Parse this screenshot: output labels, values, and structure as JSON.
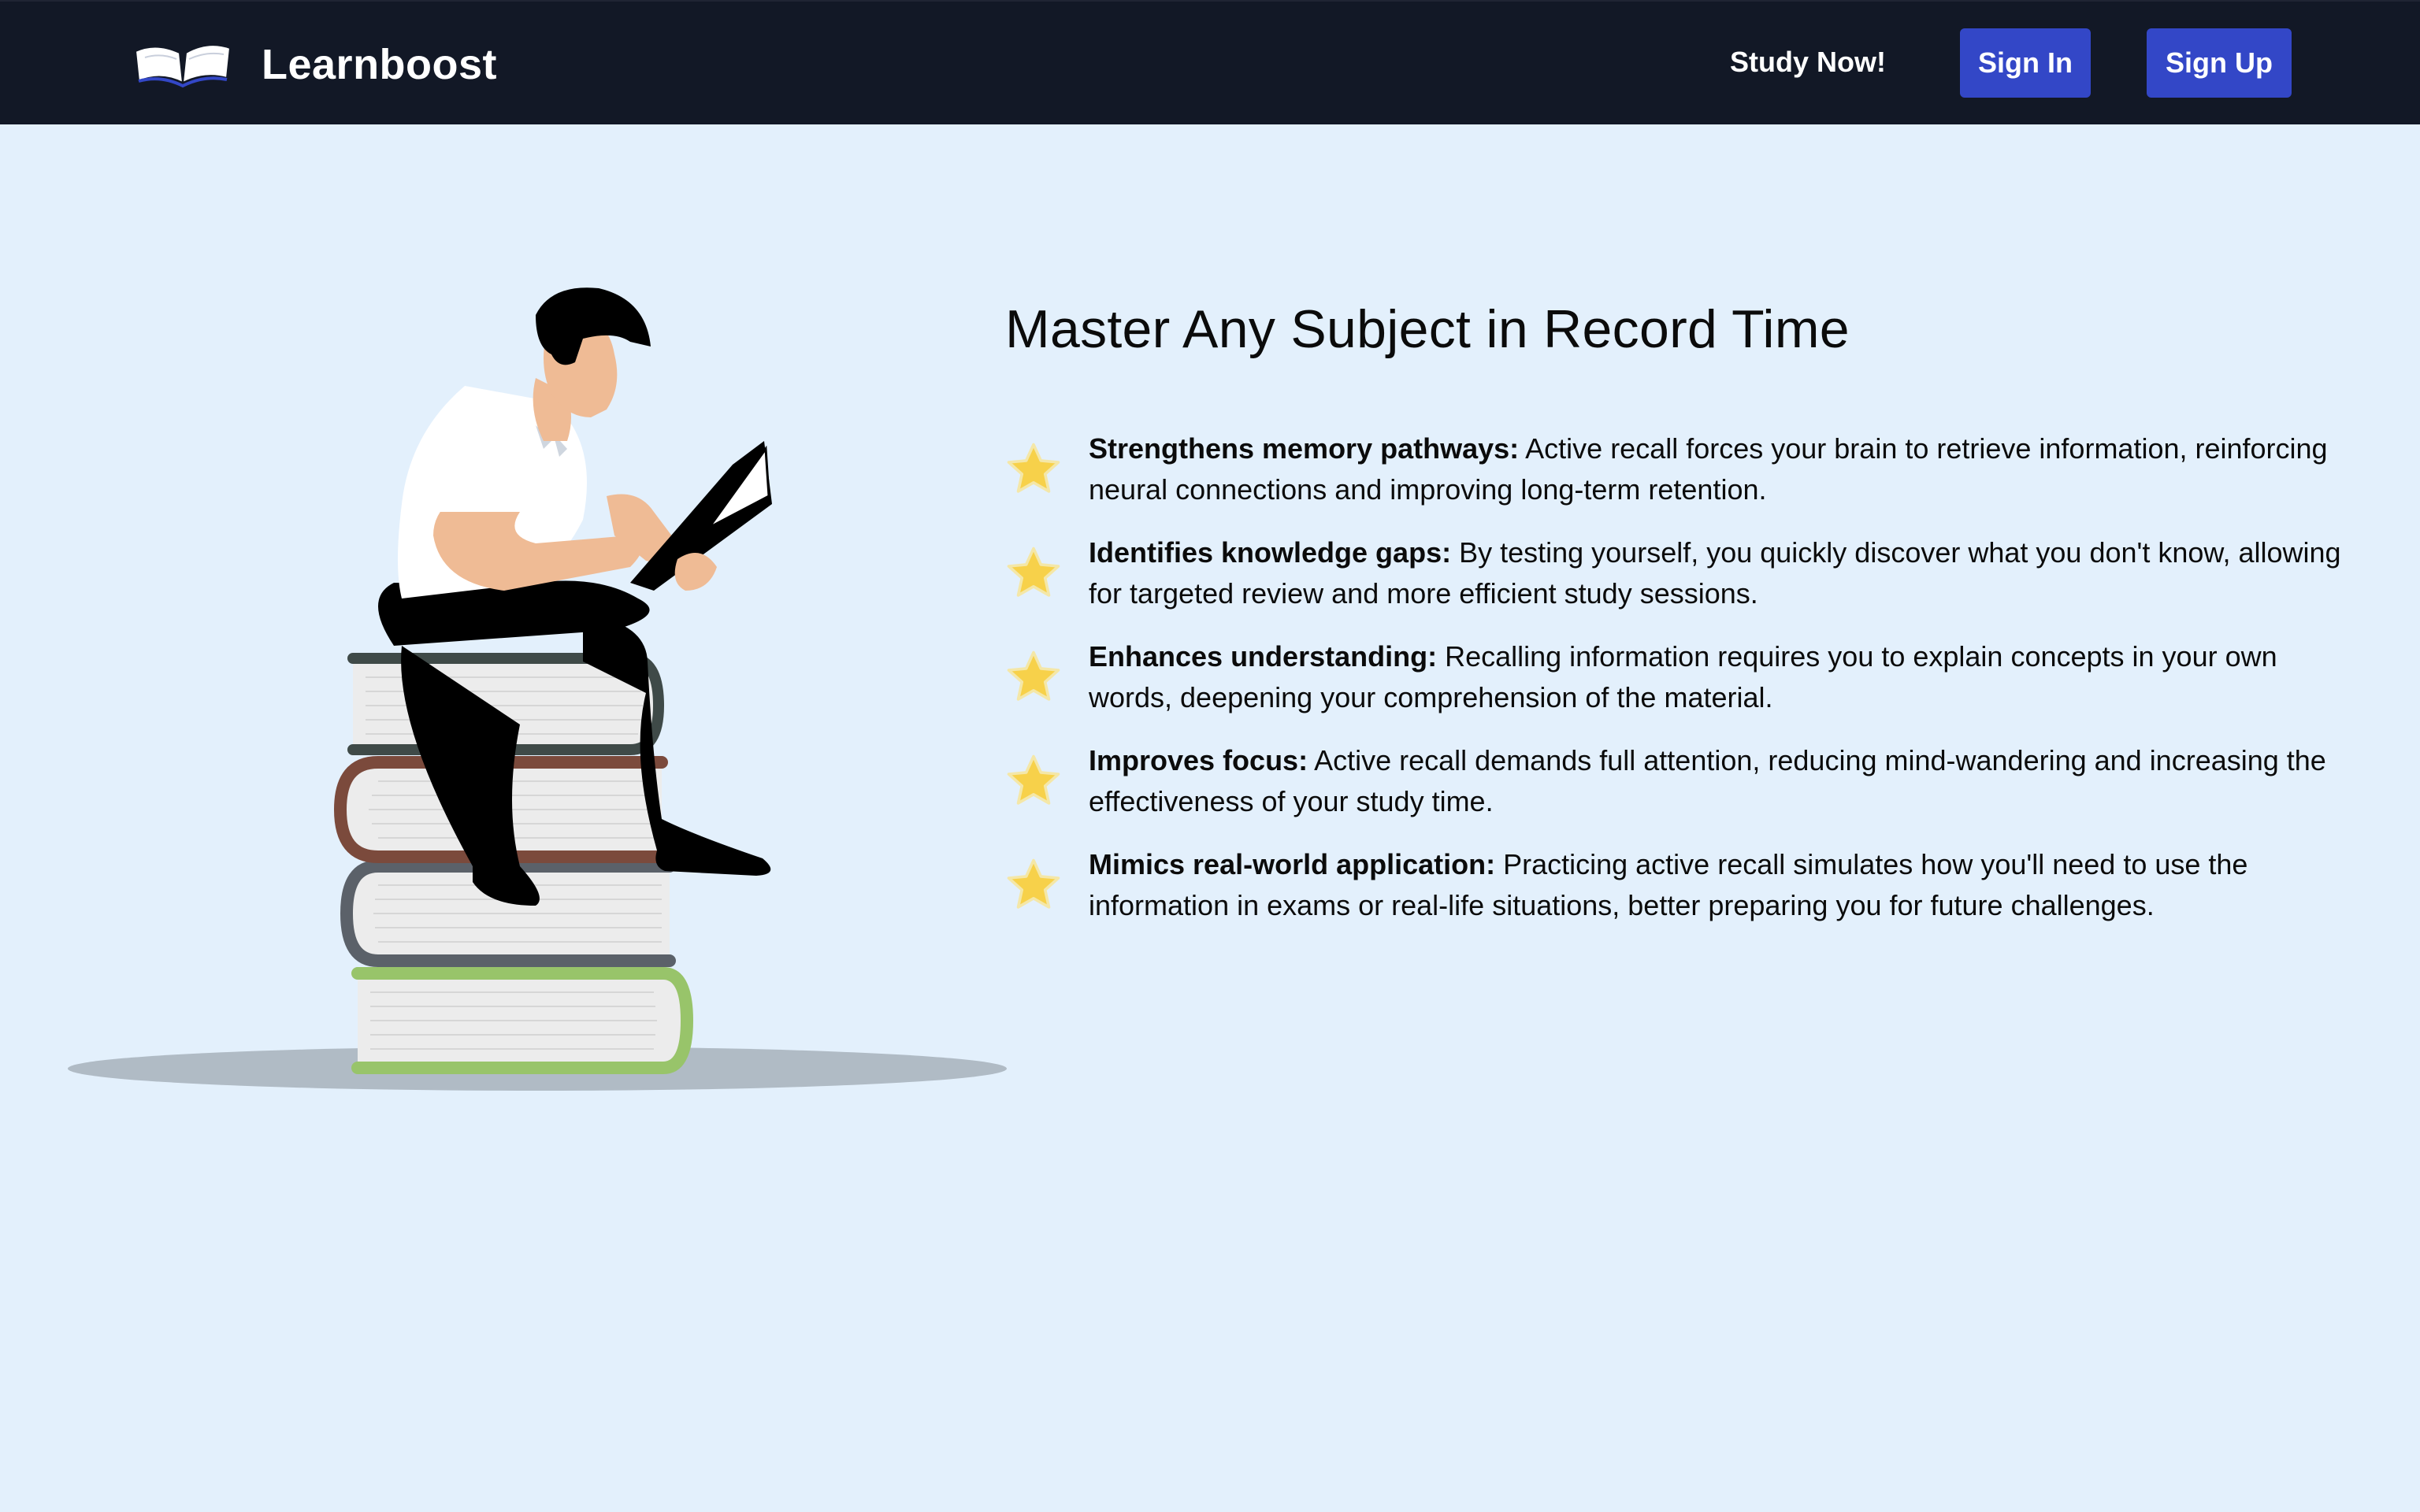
{
  "nav": {
    "brand_name": "Learnboost",
    "study_link": "Study Now!",
    "signin_label": "Sign In",
    "signup_label": "Sign Up"
  },
  "hero": {
    "headline": "Master Any Subject in Record Time",
    "features": [
      {
        "title": "Strengthens memory pathways:",
        "text": " Active recall forces your brain to retrieve information, reinforcing neural connections and improving long-term retention."
      },
      {
        "title": "Identifies knowledge gaps:",
        "text": " By testing yourself, you quickly discover what you don't know, allowing for targeted review and more efficient study sessions."
      },
      {
        "title": "Enhances understanding:",
        "text": " Recalling information requires you to explain concepts in your own words, deepening your comprehension of the material."
      },
      {
        "title": "Improves focus:",
        "text": " Active recall demands full attention, reducing mind-wandering and increasing the effectiveness of your study time."
      },
      {
        "title": "Mimics real-world application:",
        "text": " Practicing active recall simulates how you'll need to use the information in exams or real-life situations, better preparing you for future challenges."
      }
    ]
  },
  "icons": {
    "logo": "open-book-icon",
    "feature_bullet": "star-icon"
  },
  "colors": {
    "navbar_bg": "#121826",
    "page_bg": "#e3f0fc",
    "button_bg": "#3347c7",
    "star": "#f7d14a"
  }
}
